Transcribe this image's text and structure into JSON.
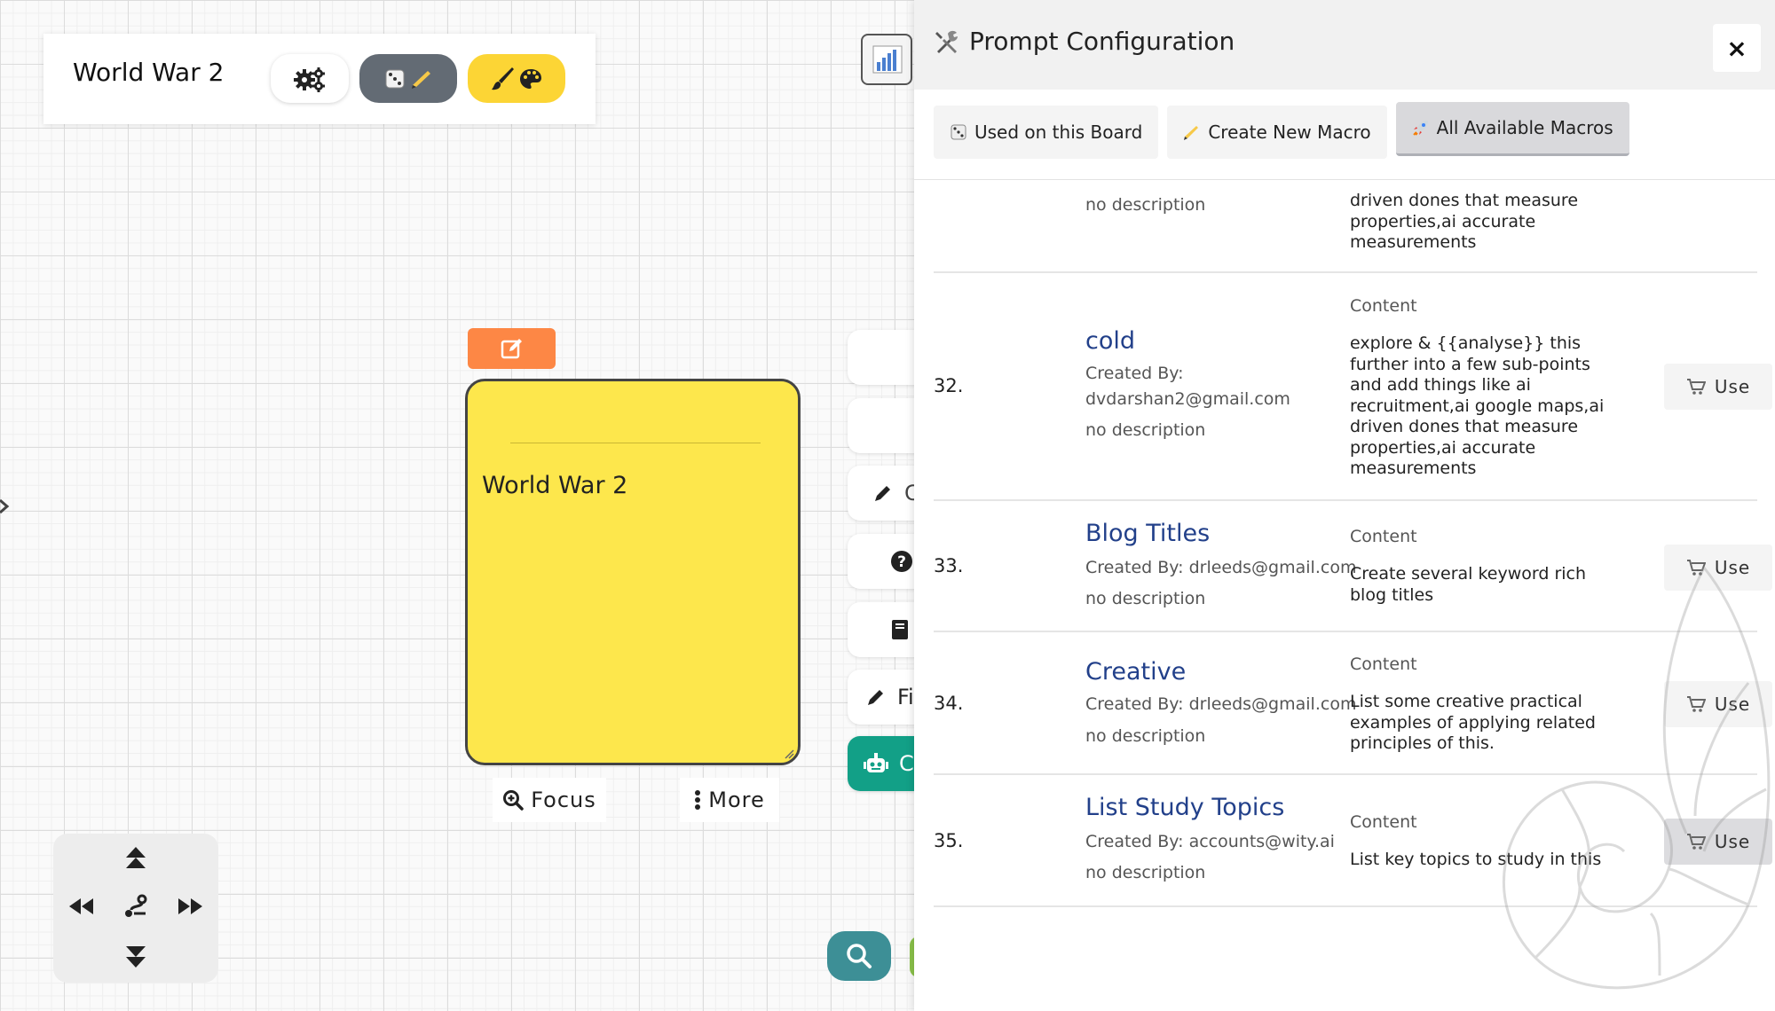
{
  "board": {
    "title": "World War 2"
  },
  "note": {
    "text": "World War 2",
    "focus_label": "Focus",
    "more_label": "More",
    "color": "#fde74c"
  },
  "side_tools": {
    "item_5_label": "Fi",
    "item_6_label": "C"
  },
  "panel": {
    "title": "Prompt Configuration",
    "close_label": "×",
    "tabs": [
      {
        "icon": "dice-icon",
        "label": "Used on this Board"
      },
      {
        "icon": "writing-hand-icon",
        "label": "Create New Macro"
      },
      {
        "icon": "rocket-icon",
        "label": "All Available Macros",
        "active": true
      }
    ],
    "partial_row": {
      "description": "no description",
      "content": "driven dones that measure properties,ai accurate measurements"
    },
    "content_label": "Content",
    "use_label": "Use",
    "macros": [
      {
        "number": "32.",
        "name": "cold",
        "created_by_label": "Created By:",
        "created_by": "dvdarshan2@gmail.com",
        "description": "no description",
        "content": "explore & {{analyse}} this further into a few sub-points and add things like ai recruitment,ai google maps,ai driven dones that measure properties,ai accurate measurements"
      },
      {
        "number": "33.",
        "name": "Blog Titles",
        "created_by_line": "Created By: drleeds@gmail.com",
        "description": "no description",
        "content": "Create several keyword rich blog titles"
      },
      {
        "number": "34.",
        "name": "Creative",
        "created_by_line": "Created By: drleeds@gmail.com",
        "description": "no description",
        "content": "List some creative practical examples of applying related principles of this."
      },
      {
        "number": "35.",
        "name": "List Study Topics",
        "created_by_line": "Created By: accounts@wity.ai",
        "description": "no description",
        "content": "List key topics to study in this"
      }
    ]
  },
  "colors": {
    "accent_orange": "#fd8745",
    "accent_yellow": "#fcd535",
    "accent_teal": "#12a087",
    "search_teal": "#3d8f96",
    "link_blue": "#22408a"
  }
}
